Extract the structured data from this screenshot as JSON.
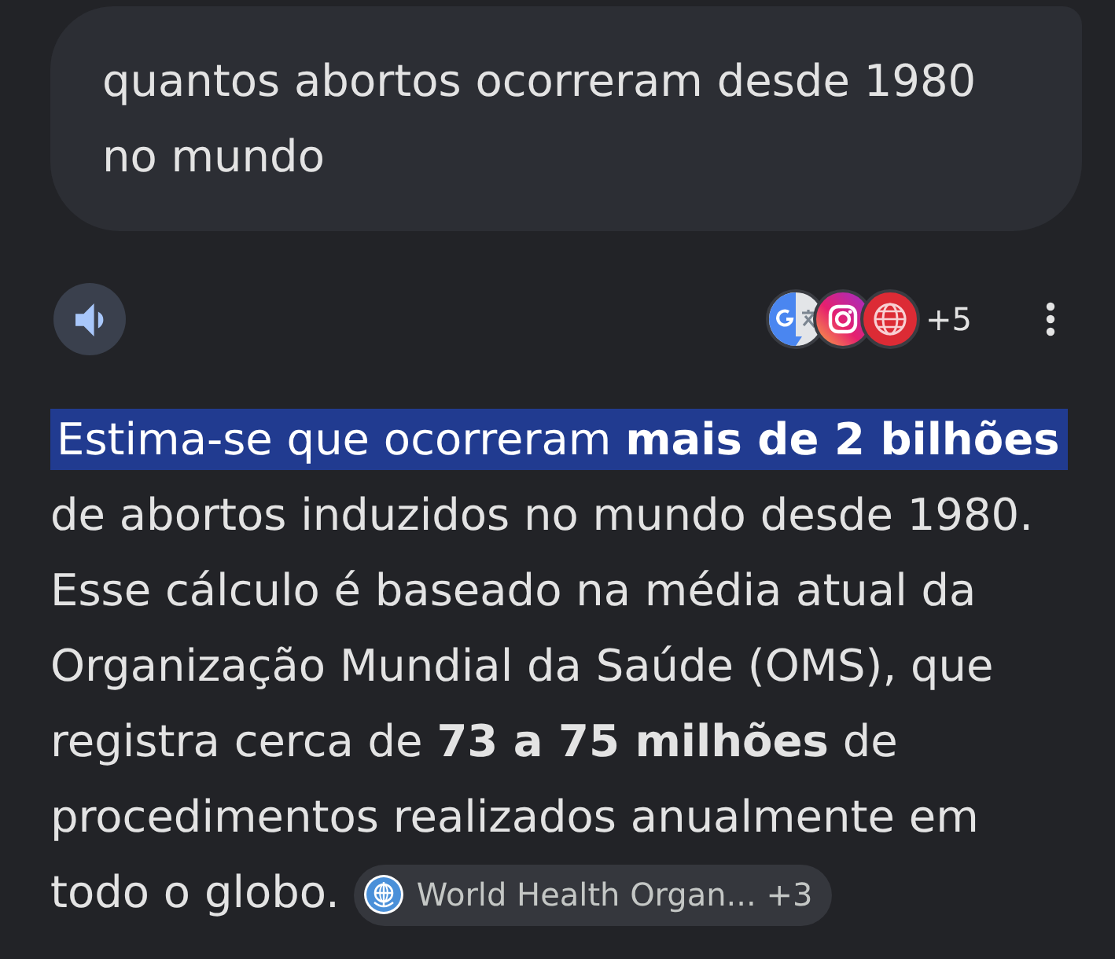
{
  "prompt": {
    "text": "quantos abortos ocorreram desde 1980 no mundo"
  },
  "toolbar": {
    "source_icons": [
      {
        "kind": "split"
      },
      {
        "kind": "camera"
      },
      {
        "kind": "globe"
      }
    ],
    "more_sources": "+5"
  },
  "answer": {
    "highlight": "Estima-se que ocorreram **mais de 2 bilhões**",
    "text": "de abortos induzidos no mundo desde 1980. Esse cálculo é baseado na média atual da Organização Mundial da Saúde (OMS), que registra cerca de **73 a 75 milhões** de procedimentos realizados anualmente em todo o globo.",
    "citation": {
      "label": "World Health Organ...",
      "count": "+3"
    }
  }
}
